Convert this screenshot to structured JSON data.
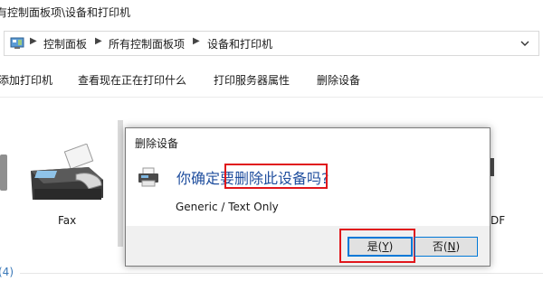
{
  "window": {
    "title": "有控制面板项\\设备和打印机"
  },
  "address": {
    "crumbs": [
      "控制面板",
      "所有控制面板项",
      "设备和打印机"
    ]
  },
  "toolbar": {
    "items": [
      "添加打印机",
      "查看现在正在打印什么",
      "打印服务器属性",
      "删除设备"
    ]
  },
  "devices": {
    "fax_label": "Fax",
    "right_label_partial": "DF",
    "group_count": "(4)"
  },
  "dialog": {
    "title": "删除设备",
    "question": "你确定要删除此设备吗?",
    "device_name": "Generic / Text Only",
    "yes_label": "是",
    "yes_key": "Y",
    "no_label": "否",
    "no_key": "N"
  },
  "colors": {
    "annotation_red": "#e0161b",
    "question_blue": "#1f4e9e",
    "group_blue": "#3b79b8",
    "button_focus": "#0078d7"
  },
  "icons": [
    "control-panel-icon",
    "chevron-right-icon",
    "chevron-down-icon",
    "fax-icon",
    "printer-icon",
    "red-arrow-icon"
  ]
}
